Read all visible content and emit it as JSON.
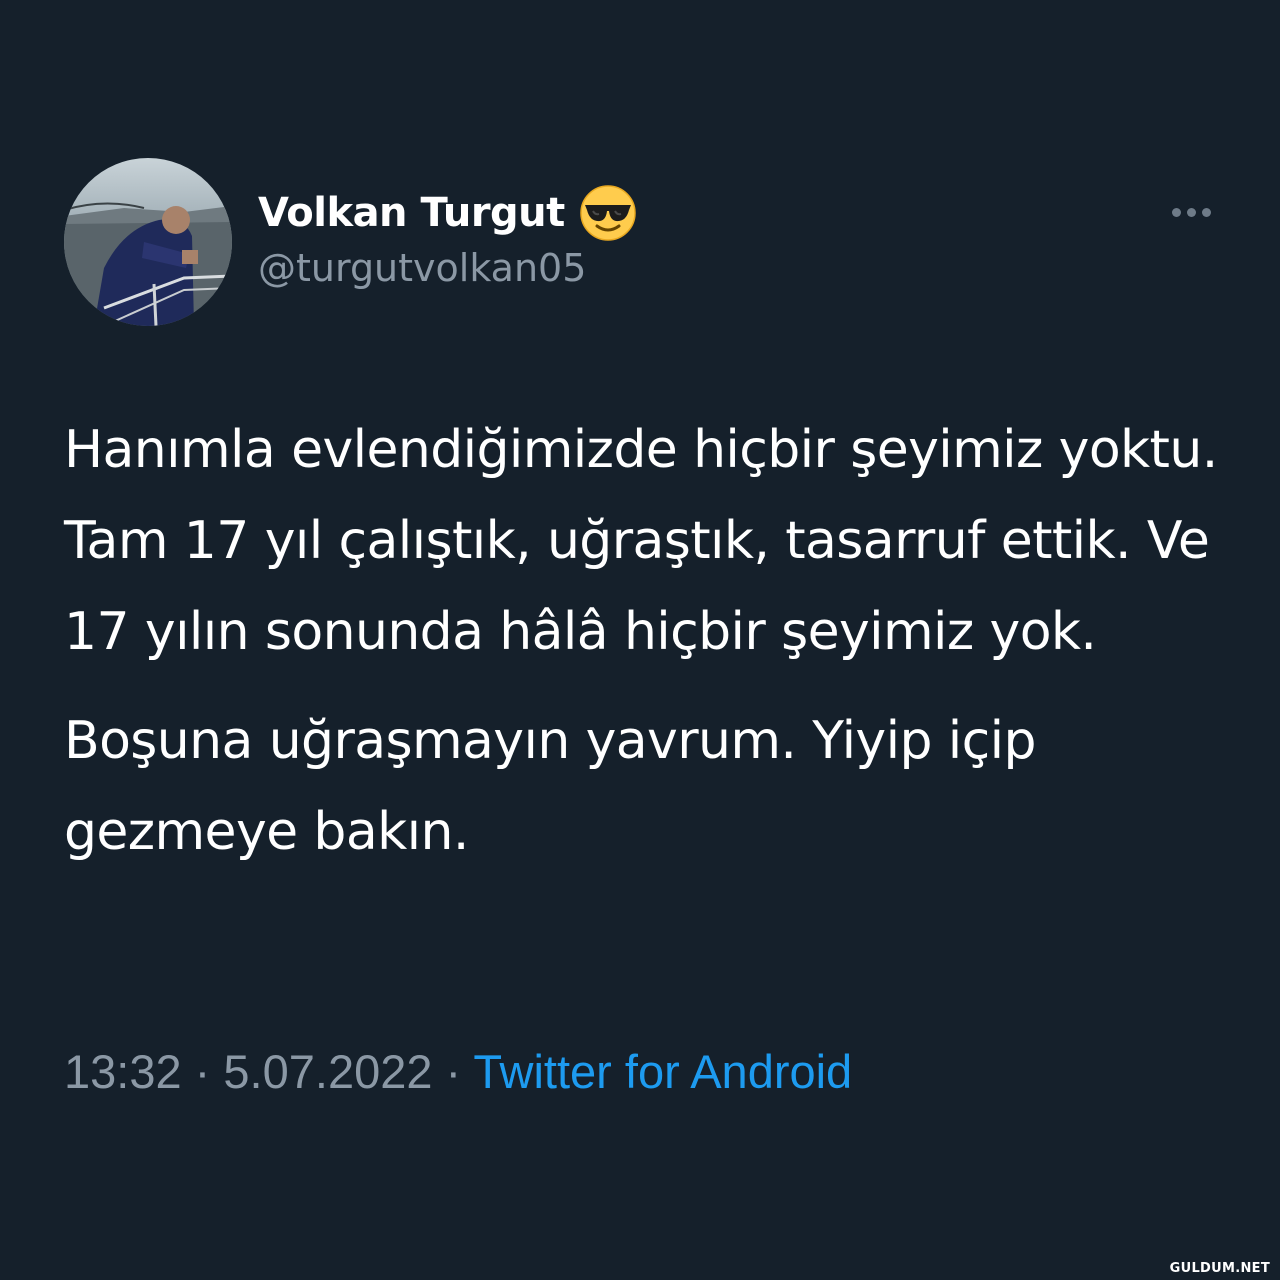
{
  "tweet": {
    "author": {
      "display_name": "Volkan Turgut",
      "name_emoji_icon": "smiling-face-with-sunglasses-icon",
      "handle": "@turgutvolkan05",
      "avatar_icon": "profile-photo"
    },
    "menu_icon": "more-options-icon",
    "text_paragraphs": [
      "Hanımla evlendiğimizde hiçbir şeyimiz yoktu. Tam 17 yıl çalıştık, uğraştık, tasarruf ettik. Ve 17 yılın sonunda hâlâ hiçbir şeyimiz yok.",
      "Boşuna uğraşmayın yavrum. Yiyip içip gezmeye bakın."
    ],
    "meta": {
      "time": "13:32",
      "separator": " · ",
      "date": "5.07.2022",
      "source": "Twitter for Android"
    }
  },
  "watermark": "GULDUM.NET",
  "colors": {
    "background": "#15202b",
    "text_primary": "#ffffff",
    "text_secondary": "#8b98a5",
    "link": "#1d9bf0"
  }
}
